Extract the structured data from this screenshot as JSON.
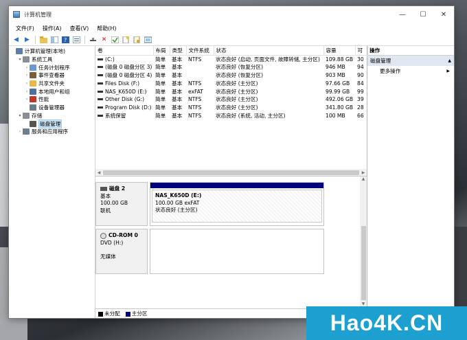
{
  "window": {
    "title": "计算机管理",
    "minimize": "—",
    "maximize": "☐",
    "close": "✕"
  },
  "menu": [
    "文件(F)",
    "操作(A)",
    "查看(V)",
    "帮助(H)"
  ],
  "tree": [
    {
      "label": "计算机管理(本地)",
      "level": 0,
      "arrow": "",
      "icon_color": "#5b7fa6"
    },
    {
      "label": "系统工具",
      "level": 1,
      "arrow": "▾",
      "icon_color": "#8a8f96"
    },
    {
      "label": "任务计划程序",
      "level": 2,
      "arrow": "›",
      "icon_color": "#6a9ad1"
    },
    {
      "label": "事件查看器",
      "level": 2,
      "arrow": "›",
      "icon_color": "#7b5e3c"
    },
    {
      "label": "共享文件夹",
      "level": 2,
      "arrow": "›",
      "icon_color": "#e5b84a"
    },
    {
      "label": "本地用户和组",
      "level": 2,
      "arrow": "›",
      "icon_color": "#4f6fa0"
    },
    {
      "label": "性能",
      "level": 2,
      "arrow": "›",
      "icon_color": "#c0392b"
    },
    {
      "label": "设备管理器",
      "level": 2,
      "arrow": "",
      "icon_color": "#6b7b8c"
    },
    {
      "label": "存储",
      "level": 1,
      "arrow": "▾",
      "icon_color": "#8a8f96"
    },
    {
      "label": "磁盘管理",
      "level": 2,
      "arrow": "",
      "icon_color": "#555555",
      "selected": true
    },
    {
      "label": "服务和应用程序",
      "level": 1,
      "arrow": "›",
      "icon_color": "#6f7f90"
    }
  ],
  "volumes": {
    "headers": [
      "卷",
      "布局",
      "类型",
      "文件系统",
      "状态",
      "容量",
      "可"
    ],
    "rows": [
      [
        "(C:)",
        "简单",
        "基本",
        "NTFS",
        "状态良好 (启动, 页面文件, 故障转储, 主分区)",
        "109.88 GB",
        "30"
      ],
      [
        "(磁盘 0 磁盘分区 3)",
        "简单",
        "基本",
        "",
        "状态良好 (恢复分区)",
        "946 MB",
        "94"
      ],
      [
        "(磁盘 0 磁盘分区 4)",
        "简单",
        "基本",
        "",
        "状态良好 (恢复分区)",
        "903 MB",
        "90"
      ],
      [
        "Files Disk (F:)",
        "简单",
        "基本",
        "NTFS",
        "状态良好 (主分区)",
        "97.66 GB",
        "84"
      ],
      [
        "NAS_K650D (E:)",
        "简单",
        "基本",
        "exFAT",
        "状态良好 (主分区)",
        "99.99 GB",
        "99"
      ],
      [
        "Other Disk (G:)",
        "简单",
        "基本",
        "NTFS",
        "状态良好 (主分区)",
        "492.06 GB",
        "39"
      ],
      [
        "Program Disk (D:)",
        "简单",
        "基本",
        "NTFS",
        "状态良好 (主分区)",
        "341.80 GB",
        "28"
      ],
      [
        "系统保留",
        "简单",
        "基本",
        "NTFS",
        "状态良好 (系统, 活动, 主分区)",
        "100 MB",
        "66"
      ]
    ]
  },
  "disks": [
    {
      "name": "磁盘 2",
      "type": "基本",
      "size": "100.00 GB",
      "state": "联机",
      "partition": {
        "name": "NAS_K650D  (E:)",
        "size_fs": "100.00 GB exFAT",
        "status": "状态良好 (主分区)"
      }
    },
    {
      "name": "CD-ROM 0",
      "type": "DVD (H:)",
      "size": "",
      "state": "无媒体"
    }
  ],
  "legend": [
    {
      "label": "未分配",
      "color": "#000000"
    },
    {
      "label": "主分区",
      "color": "#00007f"
    }
  ],
  "actions": {
    "header": "操作",
    "section": "磁盘管理",
    "more": "更多操作"
  },
  "watermark": "Hao4K.CN"
}
